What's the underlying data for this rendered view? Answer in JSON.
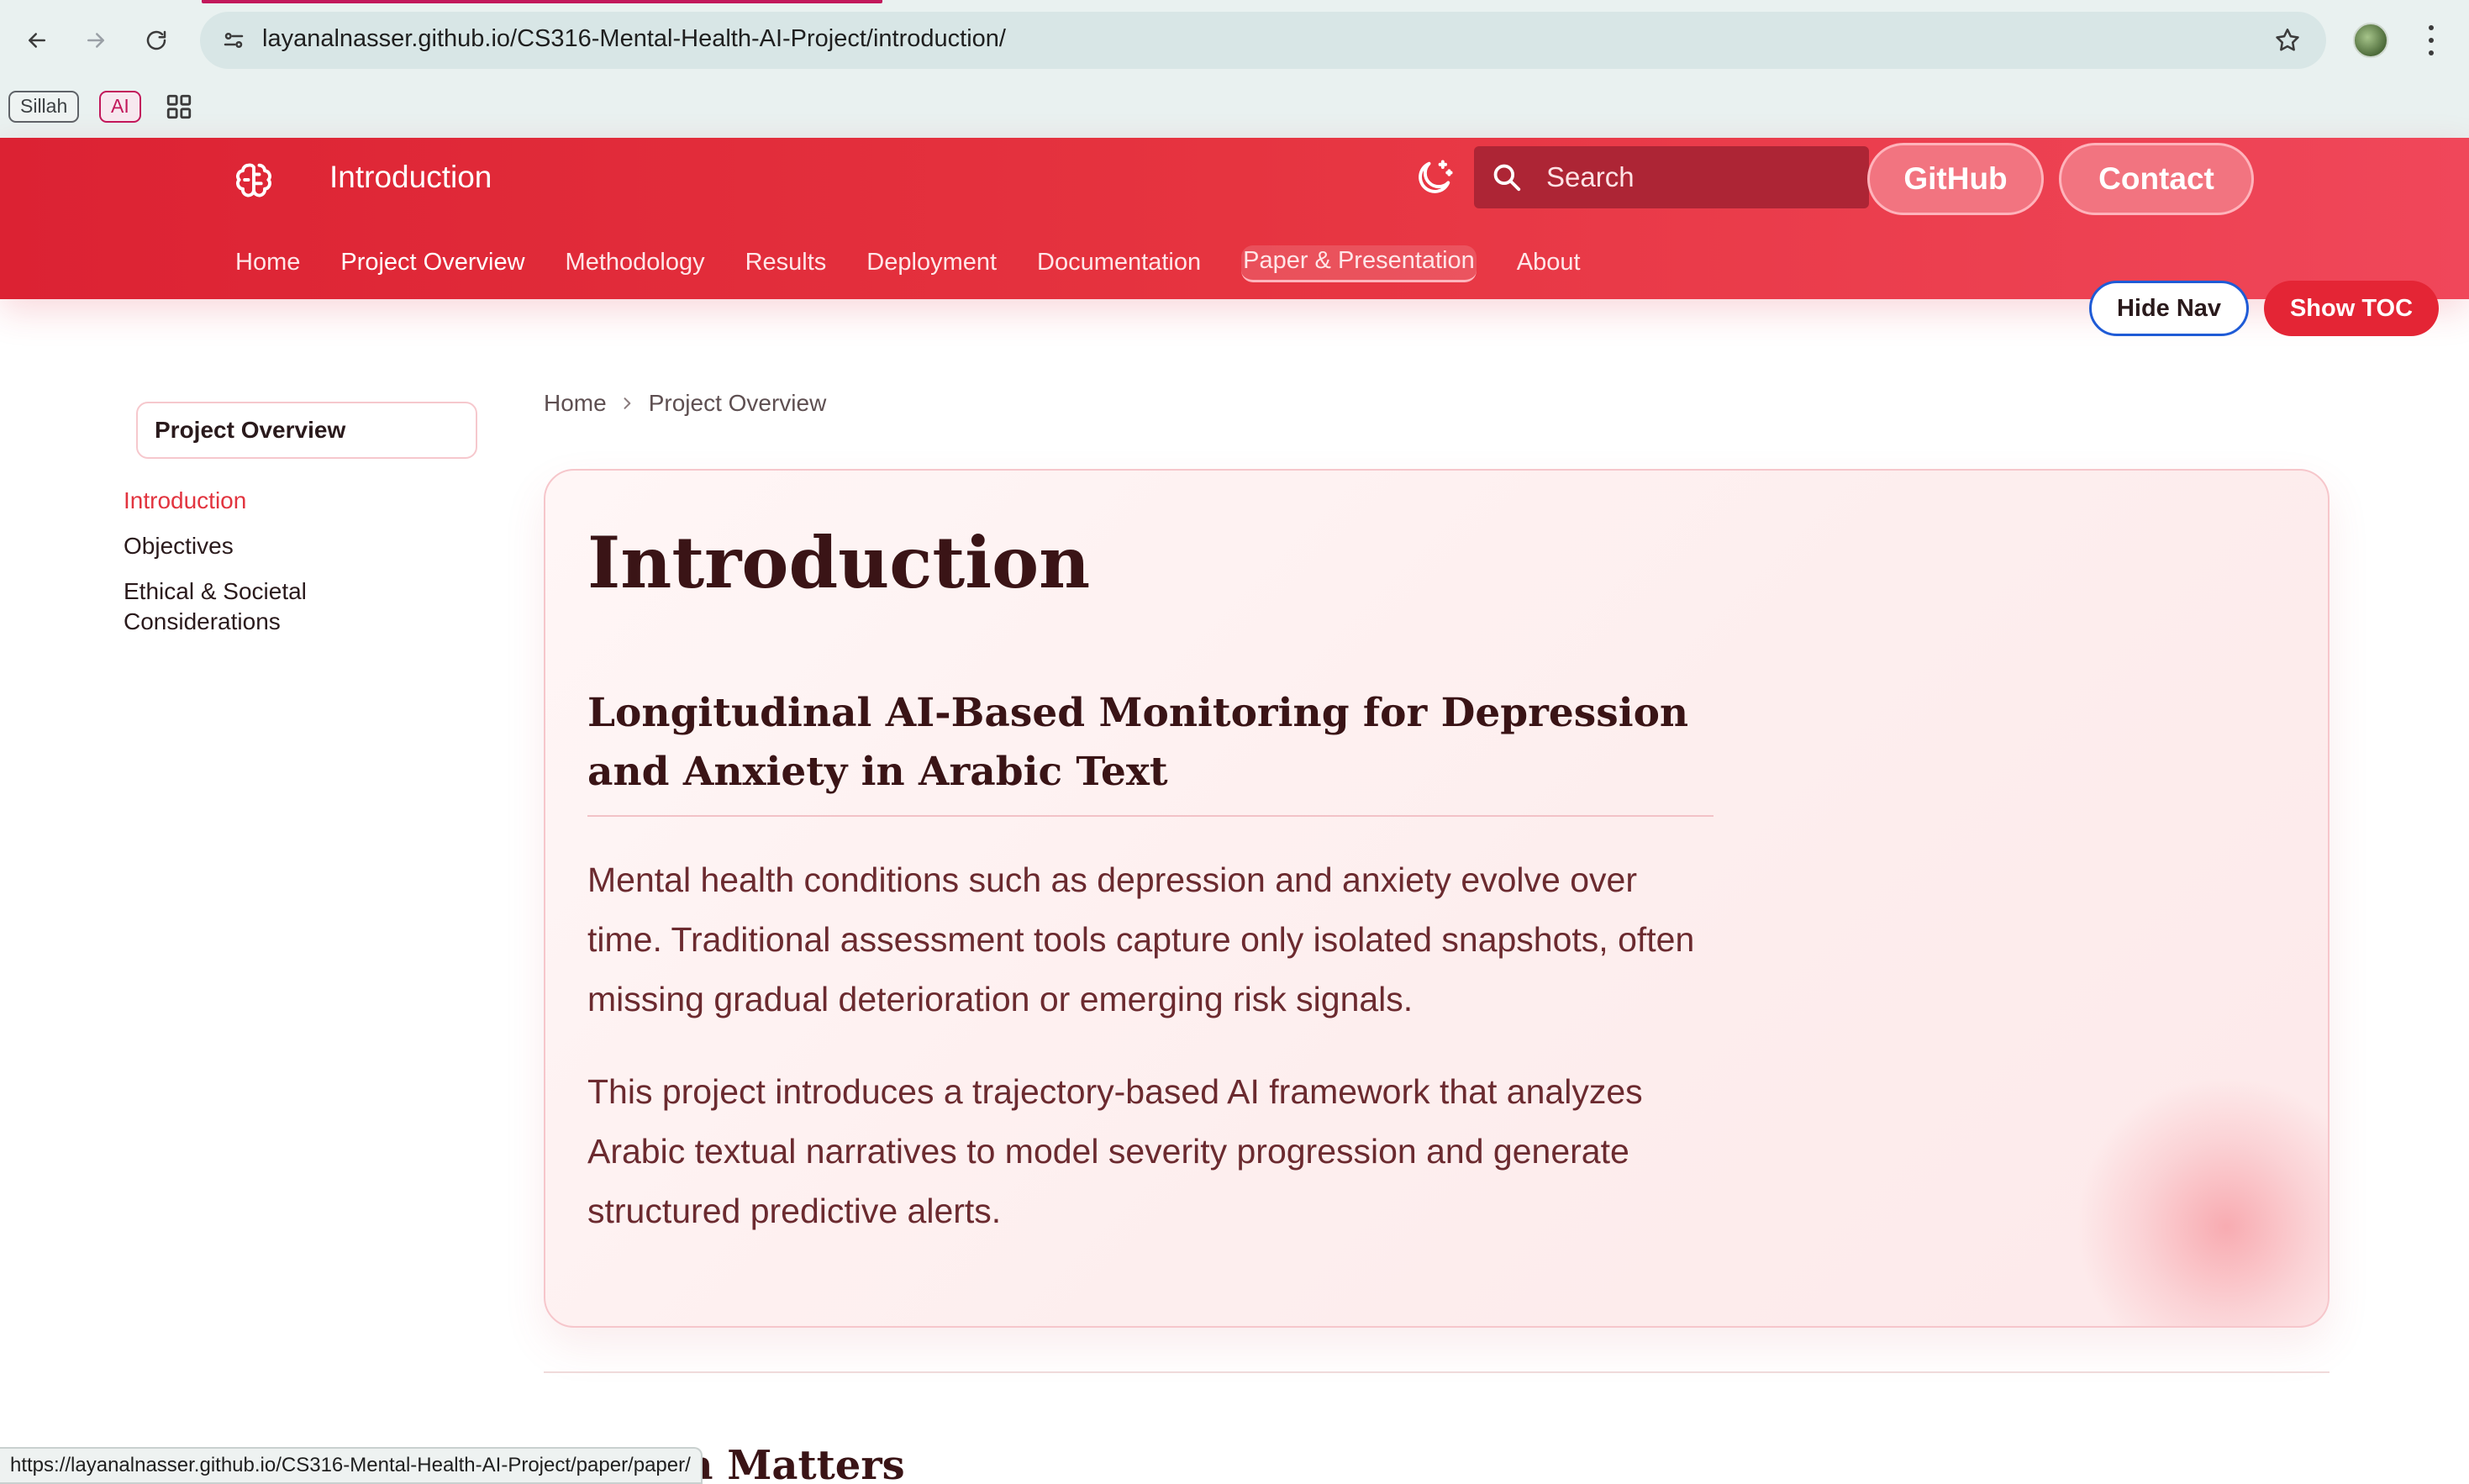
{
  "browser": {
    "url": "layanalnasser.github.io/CS316-Mental-Health-AI-Project/introduction/",
    "bookmarks": [
      {
        "label": "Sillah"
      },
      {
        "label": "AI"
      }
    ],
    "status_url": "https://layanalnasser.github.io/CS316-Mental-Health-AI-Project/paper/paper/"
  },
  "header": {
    "title": "Introduction",
    "search_placeholder": "Search",
    "github_label": "GitHub",
    "contact_label": "Contact",
    "tabs": [
      {
        "label": "Home"
      },
      {
        "label": "Project Overview"
      },
      {
        "label": "Methodology"
      },
      {
        "label": "Results"
      },
      {
        "label": "Deployment"
      },
      {
        "label": "Documentation"
      },
      {
        "label": "Paper & Presentation"
      },
      {
        "label": "About"
      }
    ],
    "hide_nav_label": "Hide Nav",
    "show_toc_label": "Show TOC"
  },
  "sidebar": {
    "section": "Project Overview",
    "items": [
      {
        "label": "Introduction"
      },
      {
        "label": "Objectives"
      },
      {
        "label": "Ethical & Societal Considerations"
      }
    ]
  },
  "breadcrumb": [
    "Home",
    "Project Overview"
  ],
  "content": {
    "title": "Introduction",
    "subtitle": "Longitudinal AI-Based Monitoring for Depression and Anxiety in Arabic Text",
    "paragraphs": [
      "Mental health conditions such as depression and anxiety evolve over time. Traditional assessment tools capture only isolated snapshots, often missing gradual deterioration or emerging risk signals.",
      "This project introduces a trajectory-based AI framework that analyzes Arabic textual narratives to model severity progression and generate structured predictive alerts."
    ],
    "next_heading": "Research Matters"
  },
  "colors": {
    "header_red": "#e63440",
    "accent": "#e2343f",
    "heading": "#3a1416",
    "body_text": "#6b2a2f"
  },
  "icons": [
    "back-icon",
    "forward-icon",
    "reload-icon",
    "site-info-icon",
    "star-icon",
    "apps-grid-icon",
    "brain-icon",
    "moon-icon",
    "search-icon",
    "chevron-right-icon"
  ]
}
